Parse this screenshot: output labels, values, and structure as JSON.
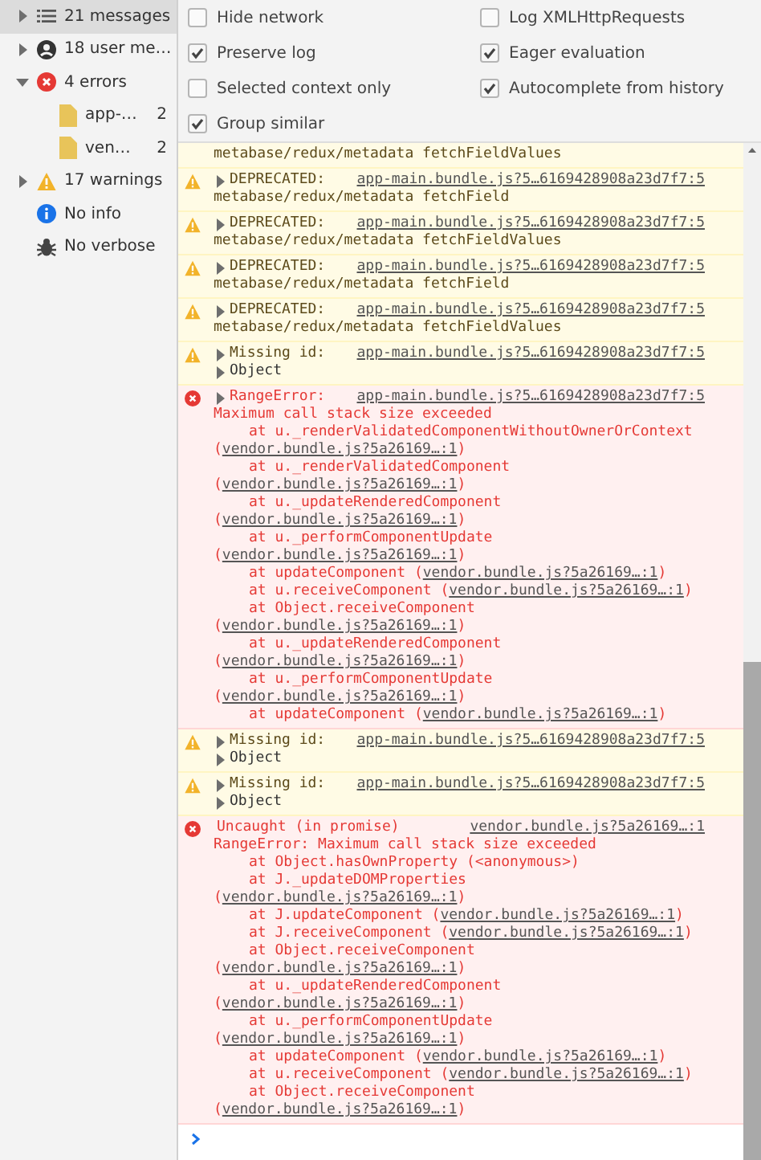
{
  "sidebar": {
    "items": [
      {
        "kind": "messages",
        "label": "21 messages",
        "selected": true,
        "expanded": false
      },
      {
        "kind": "user",
        "label": "18 user me…",
        "selected": false,
        "expanded": false
      },
      {
        "kind": "error",
        "label": "4 errors",
        "selected": false,
        "expanded": true,
        "children": [
          {
            "kind": "file",
            "label": "app-…",
            "count": "2",
            "selected": false
          },
          {
            "kind": "file",
            "label": "ven…",
            "count": "2",
            "selected": false
          }
        ]
      },
      {
        "kind": "warning",
        "label": "17 warnings",
        "selected": false,
        "expanded": false
      },
      {
        "kind": "info",
        "label": "No info",
        "selected": false
      },
      {
        "kind": "verbose",
        "label": "No verbose",
        "selected": false
      }
    ]
  },
  "settings": [
    {
      "label": "Hide network",
      "checked": false
    },
    {
      "label": "Log XMLHttpRequests",
      "checked": false
    },
    {
      "label": "Preserve log",
      "checked": true
    },
    {
      "label": "Eager evaluation",
      "checked": true
    },
    {
      "label": "Selected context only",
      "checked": false
    },
    {
      "label": "Autocomplete from history",
      "checked": true
    },
    {
      "label": "Group similar",
      "checked": true
    }
  ],
  "messages": [
    {
      "kind": "warning",
      "lines": [
        {
          "kind": "plain",
          "text": "metabase/redux/metadata fetchFieldValues"
        }
      ]
    },
    {
      "kind": "warning",
      "title": "DEPRECATED:",
      "expanded": false,
      "source": "app-main.bundle.js?5…6169428908a23d7f7:5",
      "lines": [
        {
          "kind": "plain",
          "text": "metabase/redux/metadata fetchField"
        }
      ]
    },
    {
      "kind": "warning",
      "title": "DEPRECATED:",
      "expanded": false,
      "source": "app-main.bundle.js?5…6169428908a23d7f7:5",
      "lines": [
        {
          "kind": "plain",
          "text": "metabase/redux/metadata fetchFieldValues"
        }
      ]
    },
    {
      "kind": "warning",
      "title": "DEPRECATED:",
      "expanded": false,
      "source": "app-main.bundle.js?5…6169428908a23d7f7:5",
      "lines": [
        {
          "kind": "plain",
          "text": "metabase/redux/metadata fetchField"
        }
      ]
    },
    {
      "kind": "warning",
      "title": "DEPRECATED:",
      "expanded": false,
      "source": "app-main.bundle.js?5…6169428908a23d7f7:5",
      "lines": [
        {
          "kind": "plain",
          "text": "metabase/redux/metadata fetchFieldValues"
        }
      ]
    },
    {
      "kind": "warning",
      "title": "Missing id:",
      "expanded": false,
      "source": "app-main.bundle.js?5…6169428908a23d7f7:5",
      "lines": [
        {
          "kind": "object",
          "text": "Object",
          "expanded": false
        }
      ]
    },
    {
      "kind": "error",
      "title": "RangeError:",
      "expanded": false,
      "source": "app-main.bundle.js?5…6169428908a23d7f7:5",
      "lines": [
        {
          "kind": "plain",
          "text": "Maximum call stack size exceeded"
        },
        {
          "kind": "frame",
          "text": "at u._renderValidatedComponentWithoutOwnerOrContext (",
          "link": "vendor.bundle.js?5a26169…:1",
          "after": ")"
        },
        {
          "kind": "frame",
          "text": "at u._renderValidatedComponent (",
          "link": "vendor.bundle.js?5a26169…:1",
          "after": ")"
        },
        {
          "kind": "frame",
          "text": "at u._updateRenderedComponent (",
          "link": "vendor.bundle.js?5a26169…:1",
          "after": ")"
        },
        {
          "kind": "frame",
          "text": "at u._performComponentUpdate (",
          "link": "vendor.bundle.js?5a26169…:1",
          "after": ")"
        },
        {
          "kind": "frame",
          "text": "at updateComponent (",
          "link": "vendor.bundle.js?5a26169…:1",
          "after": ")"
        },
        {
          "kind": "frame",
          "text": "at u.receiveComponent (",
          "link": "vendor.bundle.js?5a26169…:1",
          "after": ")"
        },
        {
          "kind": "frame",
          "text": "at Object.receiveComponent (",
          "link": "vendor.bundle.js?5a26169…:1",
          "after": ")"
        },
        {
          "kind": "frame",
          "text": "at u._updateRenderedComponent (",
          "link": "vendor.bundle.js?5a26169…:1",
          "after": ")"
        },
        {
          "kind": "frame",
          "text": "at u._performComponentUpdate (",
          "link": "vendor.bundle.js?5a26169…:1",
          "after": ")"
        },
        {
          "kind": "frame",
          "text": "at updateComponent (",
          "link": "vendor.bundle.js?5a26169…:1",
          "after": ")"
        }
      ]
    },
    {
      "kind": "warning",
      "title": "Missing id:",
      "expanded": false,
      "source": "app-main.bundle.js?5…6169428908a23d7f7:5",
      "lines": [
        {
          "kind": "object",
          "text": "Object",
          "expanded": false
        }
      ]
    },
    {
      "kind": "warning",
      "title": "Missing id:",
      "expanded": false,
      "source": "app-main.bundle.js?5…6169428908a23d7f7:5",
      "lines": [
        {
          "kind": "object",
          "text": "Object",
          "expanded": false
        }
      ]
    },
    {
      "kind": "error",
      "title": "Uncaught (in promise)",
      "source": "vendor.bundle.js?5a26169…:1",
      "lines": [
        {
          "kind": "plain",
          "text": "RangeError: Maximum call stack size exceeded"
        },
        {
          "kind": "frame",
          "text": "at Object.hasOwnProperty (<anonymous>)"
        },
        {
          "kind": "frame",
          "text": "at J._updateDOMProperties (",
          "link": "vendor.bundle.js?5a26169…:1",
          "after": ")"
        },
        {
          "kind": "frame",
          "text": "at J.updateComponent (",
          "link": "vendor.bundle.js?5a26169…:1",
          "after": ")"
        },
        {
          "kind": "frame",
          "text": "at J.receiveComponent (",
          "link": "vendor.bundle.js?5a26169…:1",
          "after": ")"
        },
        {
          "kind": "frame",
          "text": "at Object.receiveComponent (",
          "link": "vendor.bundle.js?5a26169…:1",
          "after": ")"
        },
        {
          "kind": "frame",
          "text": "at u._updateRenderedComponent (",
          "link": "vendor.bundle.js?5a26169…:1",
          "after": ")"
        },
        {
          "kind": "frame",
          "text": "at u._performComponentUpdate (",
          "link": "vendor.bundle.js?5a26169…:1",
          "after": ")"
        },
        {
          "kind": "frame",
          "text": "at updateComponent (",
          "link": "vendor.bundle.js?5a26169…:1",
          "after": ")"
        },
        {
          "kind": "frame",
          "text": "at u.receiveComponent (",
          "link": "vendor.bundle.js?5a26169…:1",
          "after": ")"
        },
        {
          "kind": "frame",
          "text": "at Object.receiveComponent (",
          "link": "vendor.bundle.js?5a26169…:1",
          "after": ")"
        }
      ]
    }
  ]
}
